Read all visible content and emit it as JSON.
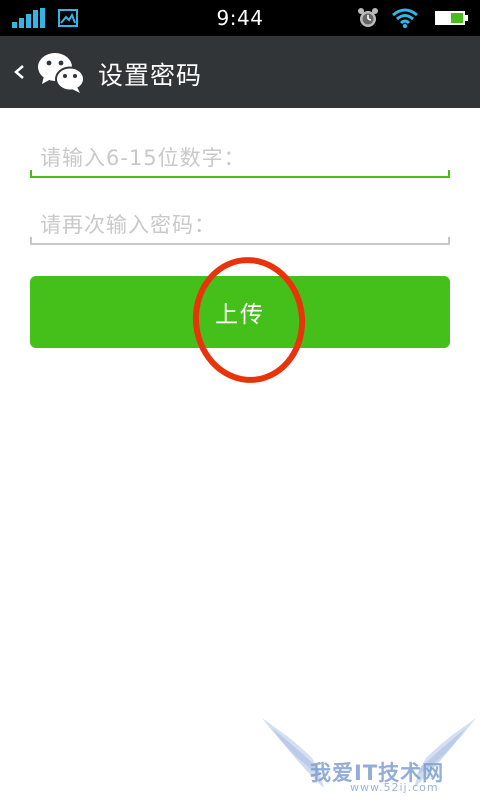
{
  "status_bar": {
    "time": "9:44",
    "icons": [
      "signal-icon",
      "gallery-icon",
      "alarm-icon",
      "wifi-icon",
      "battery-icon"
    ]
  },
  "action_bar": {
    "back_icon": "chevron-left-icon",
    "logo_icon": "wechat-logo-icon",
    "title": "设置密码"
  },
  "form": {
    "password_placeholder": "请输入6-15位数字：",
    "password_value": "",
    "confirm_placeholder": "请再次输入密码：",
    "confirm_value": "",
    "submit_label": "上传"
  },
  "watermark": {
    "text": "我爱IT技术网",
    "sub": "www.52ij.com"
  },
  "colors": {
    "accent": "#45c01a",
    "action_bar": "#323538",
    "highlight": "#e8340b"
  }
}
